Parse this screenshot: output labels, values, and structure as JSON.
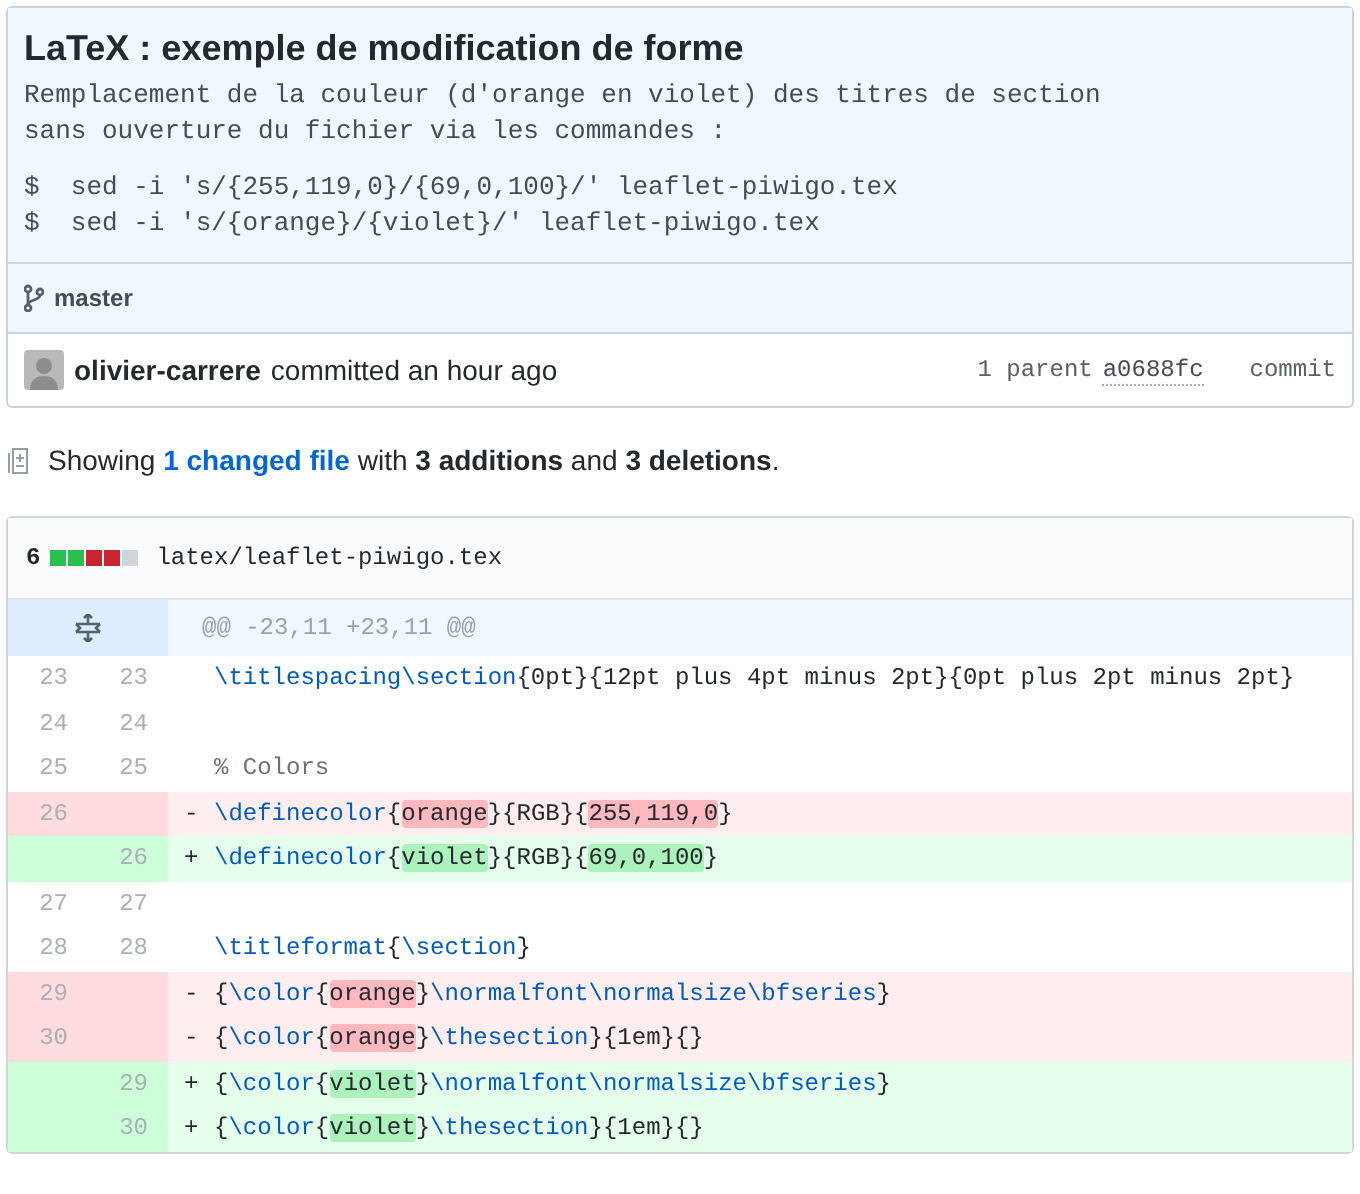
{
  "commit": {
    "title": "LaTeX : exemple de modification de forme",
    "description": [
      "Remplacement de la couleur (d'orange en violet) des titres de section",
      "sans ouverture du fichier via les commandes :"
    ],
    "commands": [
      "$  sed -i 's/{255,119,0}/{69,0,100}/' leaflet-piwigo.tex",
      "$  sed -i 's/{orange}/{violet}/' leaflet-piwigo.tex"
    ],
    "branch": "master",
    "author": "olivier-carrere",
    "action": "committed an hour ago",
    "parent_label": "1 parent",
    "parent_sha": "a0688fc",
    "commit_label": "commit"
  },
  "summary": {
    "prefix": "Showing",
    "changed": "1 changed file",
    "middle": "with",
    "additions": "3 additions",
    "and": "and",
    "deletions": "3 deletions",
    "suffix": "."
  },
  "file": {
    "count": "6",
    "stat": [
      {
        "kind": "added"
      },
      {
        "kind": "added"
      },
      {
        "kind": "deleted"
      },
      {
        "kind": "deleted"
      },
      {
        "kind": "neutral"
      }
    ],
    "path": "latex/leaflet-piwigo.tex",
    "hunk": "@@ -23,11 +23,11 @@",
    "lines": [
      {
        "kind": "context",
        "old": "23",
        "new": "23",
        "code": [
          {
            "text": "\\titlespacing\\section",
            "kind": "cmd"
          },
          {
            "text": "{0pt}{12pt plus 4pt minus 2pt}{0pt plus 2pt minus 2pt}",
            "kind": "plain"
          }
        ]
      },
      {
        "kind": "context",
        "old": "24",
        "new": "24"
      },
      {
        "kind": "context",
        "old": "25",
        "new": "25",
        "code": [
          {
            "text": "% Colors",
            "kind": "comment"
          }
        ]
      },
      {
        "kind": "deletion",
        "old": "26",
        "marker": "-",
        "code": [
          {
            "text": "\\definecolor",
            "kind": "cmd"
          },
          {
            "text": "{",
            "kind": "plain"
          },
          {
            "text": "orange",
            "kind": "change"
          },
          {
            "text": "}{RGB}{",
            "kind": "plain"
          },
          {
            "text": "255,119,0",
            "kind": "change"
          },
          {
            "text": "}",
            "kind": "plain"
          }
        ]
      },
      {
        "kind": "addition",
        "new": "26",
        "marker": "+",
        "code": [
          {
            "text": "\\definecolor",
            "kind": "cmd"
          },
          {
            "text": "{",
            "kind": "plain"
          },
          {
            "text": "violet",
            "kind": "change"
          },
          {
            "text": "}{RGB}{",
            "kind": "plain"
          },
          {
            "text": "69,0,100",
            "kind": "change"
          },
          {
            "text": "}",
            "kind": "plain"
          }
        ]
      },
      {
        "kind": "context",
        "old": "27",
        "new": "27"
      },
      {
        "kind": "context",
        "old": "28",
        "new": "28",
        "code": [
          {
            "text": "\\titleformat",
            "kind": "cmd"
          },
          {
            "text": "{",
            "kind": "plain"
          },
          {
            "text": "\\section",
            "kind": "cmd"
          },
          {
            "text": "}",
            "kind": "plain"
          }
        ]
      },
      {
        "kind": "deletion",
        "old": "29",
        "marker": "-",
        "code": [
          {
            "text": "{",
            "kind": "plain"
          },
          {
            "text": "\\color",
            "kind": "cmd"
          },
          {
            "text": "{",
            "kind": "plain"
          },
          {
            "text": "orange",
            "kind": "change"
          },
          {
            "text": "}",
            "kind": "plain"
          },
          {
            "text": "\\normalfont\\normalsize\\bfseries",
            "kind": "cmd"
          },
          {
            "text": "}",
            "kind": "plain"
          }
        ]
      },
      {
        "kind": "deletion",
        "old": "30",
        "marker": "-",
        "code": [
          {
            "text": "{",
            "kind": "plain"
          },
          {
            "text": "\\color",
            "kind": "cmd"
          },
          {
            "text": "{",
            "kind": "plain"
          },
          {
            "text": "orange",
            "kind": "change"
          },
          {
            "text": "}",
            "kind": "plain"
          },
          {
            "text": "\\thesection",
            "kind": "cmd"
          },
          {
            "text": "}{1em}{}",
            "kind": "plain"
          }
        ]
      },
      {
        "kind": "addition",
        "new": "29",
        "marker": "+",
        "code": [
          {
            "text": "{",
            "kind": "plain"
          },
          {
            "text": "\\color",
            "kind": "cmd"
          },
          {
            "text": "{",
            "kind": "plain"
          },
          {
            "text": "violet",
            "kind": "change"
          },
          {
            "text": "}",
            "kind": "plain"
          },
          {
            "text": "\\normalfont\\normalsize\\bfseries",
            "kind": "cmd"
          },
          {
            "text": "}",
            "kind": "plain"
          }
        ]
      },
      {
        "kind": "addition",
        "new": "30",
        "marker": "+",
        "code": [
          {
            "text": "{",
            "kind": "plain"
          },
          {
            "text": "\\color",
            "kind": "cmd"
          },
          {
            "text": "{",
            "kind": "plain"
          },
          {
            "text": "violet",
            "kind": "change"
          },
          {
            "text": "}",
            "kind": "plain"
          },
          {
            "text": "\\thesection",
            "kind": "cmd"
          },
          {
            "text": "}{1em}{}",
            "kind": "plain"
          }
        ]
      }
    ]
  }
}
